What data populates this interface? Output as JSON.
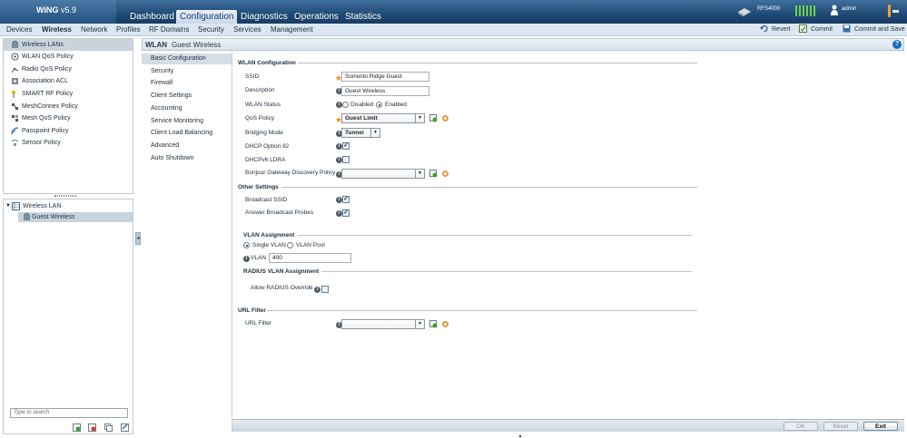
{
  "header": {
    "logo_name": "WiNG",
    "logo_version": "v5.9",
    "main_tabs": [
      "Dashboard",
      "Configuration",
      "Diagnostics",
      "Operations",
      "Statistics"
    ],
    "active_main_tab": "Configuration",
    "device_name": "RFS4000",
    "user": "admin"
  },
  "subnav": {
    "tabs": [
      "Devices",
      "Wireless",
      "Network",
      "Profiles",
      "RF Domains",
      "Security",
      "Services",
      "Management"
    ],
    "active": "Wireless",
    "revert": "Revert",
    "commit": "Commit",
    "commit_save": "Commit and Save"
  },
  "left_nav": {
    "items": [
      {
        "label": "Wireless LANs",
        "icon": "wireless-lan-icon"
      },
      {
        "label": "WLAN QoS Policy",
        "icon": "qos-icon"
      },
      {
        "label": "Radio QoS Policy",
        "icon": "radio-qos-icon"
      },
      {
        "label": "Association ACL",
        "icon": "acl-icon"
      },
      {
        "label": "SMART RF Policy",
        "icon": "smart-rf-icon"
      },
      {
        "label": "MeshConnex Policy",
        "icon": "meshconnex-icon"
      },
      {
        "label": "Mesh QoS Policy",
        "icon": "mesh-qos-icon"
      },
      {
        "label": "Passpoint Policy",
        "icon": "passpoint-icon"
      },
      {
        "label": "Sensor Policy",
        "icon": "sensor-icon"
      }
    ],
    "selected": "Wireless LANs"
  },
  "tree": {
    "root": "Wireless LAN",
    "child": "Guest Wireless",
    "search_placeholder": "Type to search"
  },
  "content": {
    "title": "WLAN",
    "subtitle": "Guest Wireless",
    "menu": [
      "Basic Configuration",
      "Security",
      "Firewall",
      "Client Settings",
      "Accounting",
      "Service Monitoring",
      "Client Load Balancing",
      "Advanced",
      "Auto Shutdown"
    ],
    "selected_menu": "Basic Configuration"
  },
  "form": {
    "wlan_config_title": "WLAN Configuration",
    "ssid_label": "SSID",
    "ssid_value": "Sorrento Ridge Guest",
    "description_label": "Description",
    "description_value": "Guest Wireless",
    "status_label": "WLAN Status",
    "status_disabled": "Disabled",
    "status_enabled": "Enabled",
    "qos_label": "QoS Policy",
    "qos_value": "Guest Limit",
    "bridging_label": "Bridging Mode",
    "bridging_value": "Tunnel",
    "dhcp82_label": "DHCP Option 82",
    "dhcpv6_label": "DHCPv6 LDRA",
    "bonjour_label": "Bonjour Gateway Discovery Policy",
    "bonjour_value": "",
    "other_title": "Other Settings",
    "broadcast_label": "Broadcast SSID",
    "answer_label": "Answer Broadcast Probes",
    "vlan_assign_title": "VLAN Assignment",
    "single_vlan": "Single VLAN",
    "vlan_pool": "VLAN Pool",
    "vlan_label": "VLAN",
    "vlan_value": "400",
    "radius_title": "RADIUS VLAN Assignment",
    "radius_label": "Allow RADIUS Override",
    "url_title": "URL Filter",
    "url_label": "URL Filter",
    "url_value": ""
  },
  "footer": {
    "ok": "OK",
    "reset": "Reset",
    "exit": "Exit"
  },
  "colors": {
    "topbar": "#1f4a76",
    "accent_orange": "#f08a18",
    "signal_green": "#6fd34a"
  }
}
